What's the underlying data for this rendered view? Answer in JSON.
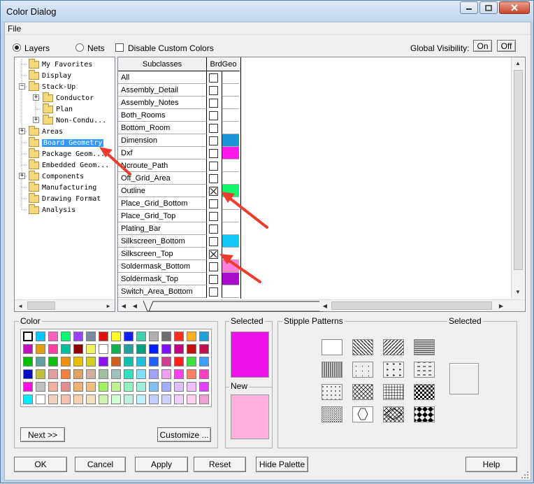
{
  "window": {
    "title": "Color Dialog"
  },
  "menu": {
    "file": "File"
  },
  "top_controls": {
    "layers_label": "Layers",
    "nets_label": "Nets",
    "disable_custom_label": "Disable Custom Colors",
    "global_visibility_label": "Global Visibility:",
    "on_label": "On",
    "off_label": "Off",
    "selected_radio": "Layers"
  },
  "tree": {
    "items": [
      {
        "label": "My Favorites",
        "selected": false
      },
      {
        "label": "Display",
        "selected": false
      },
      {
        "label": "Stack-Up",
        "selected": false
      },
      {
        "label": "Conductor",
        "selected": false
      },
      {
        "label": "Plan",
        "selected": false
      },
      {
        "label": "Non-Condu...",
        "selected": false
      },
      {
        "label": "Areas",
        "selected": false
      },
      {
        "label": "Board Geometry",
        "selected": true
      },
      {
        "label": "Package Geom...",
        "selected": false
      },
      {
        "label": "Embedded Geom...",
        "selected": false
      },
      {
        "label": "Components",
        "selected": false
      },
      {
        "label": "Manufacturing",
        "selected": false
      },
      {
        "label": "Drawing Format",
        "selected": false
      },
      {
        "label": "Analysis",
        "selected": false
      }
    ]
  },
  "grid": {
    "col_subclasses": "Subclasses",
    "col_brdgeo": "BrdGeo",
    "rows": [
      {
        "name": "All",
        "checked": false,
        "color": "#ffffff"
      },
      {
        "name": "Assembly_Detail",
        "checked": false,
        "color": "#ffffff"
      },
      {
        "name": "Assembly_Notes",
        "checked": false,
        "color": "#ffffff"
      },
      {
        "name": "Both_Rooms",
        "checked": false,
        "color": "#ffffff"
      },
      {
        "name": "Bottom_Room",
        "checked": false,
        "color": "#ffffff"
      },
      {
        "name": "Dimension",
        "checked": false,
        "color": "#1a96d6"
      },
      {
        "name": "Dxf",
        "checked": false,
        "color": "#ff18ec"
      },
      {
        "name": "Ncroute_Path",
        "checked": false,
        "color": "#ffffff"
      },
      {
        "name": "Off_Grid_Area",
        "checked": false,
        "color": "#ffffff"
      },
      {
        "name": "Outline",
        "checked": true,
        "color": "#10f56a"
      },
      {
        "name": "Place_Grid_Bottom",
        "checked": false,
        "color": "#ffffff"
      },
      {
        "name": "Place_Grid_Top",
        "checked": false,
        "color": "#ffffff"
      },
      {
        "name": "Plating_Bar",
        "checked": false,
        "color": "#ffffff"
      },
      {
        "name": "Silkscreen_Bottom",
        "checked": false,
        "color": "#11c8f6"
      },
      {
        "name": "Silkscreen_Top",
        "checked": true,
        "color": "#ffffff"
      },
      {
        "name": "Soldermask_Bottom",
        "checked": false,
        "color": "#ff7fd8"
      },
      {
        "name": "Soldermask_Top",
        "checked": false,
        "color": "#a80ccc"
      },
      {
        "name": "Switch_Area_Bottom",
        "checked": false,
        "color": "#ffffff"
      }
    ]
  },
  "color_panel": {
    "title": "Color",
    "next_label": "Next >>",
    "customize_label": "Customize ...",
    "palette": [
      "#ffffff",
      "#00c8ff",
      "#ff60c0",
      "#00ff70",
      "#9a40ff",
      "#7a8aa0",
      "#e01010",
      "#ffff20",
      "#1020ff",
      "#40d0b0",
      "#b0b0b0",
      "#707070",
      "#ff3020",
      "#ffb020",
      "#20a0e0",
      "#c010c0",
      "#e0a010",
      "#ff40a0",
      "#00c0a0",
      "#8c0000",
      "#f0f060",
      "#ffffff",
      "#10b050",
      "#20a0a0",
      "#00a080",
      "#0020ff",
      "#8010ff",
      "#c00080",
      "#c01010",
      "#c01050",
      "#00c000",
      "#60a0a0",
      "#10c010",
      "#f09010",
      "#e8c000",
      "#d0d020",
      "#9010f0",
      "#d06020",
      "#10c0b0",
      "#20c0e0",
      "#2060ff",
      "#d04090",
      "#ff2020",
      "#40e040",
      "#40a0ff",
      "#0010c0",
      "#c0c040",
      "#e0a0a0",
      "#f08040",
      "#e0a060",
      "#d0b0a0",
      "#a0c0a0",
      "#a0c0c0",
      "#30e0c0",
      "#80e0ff",
      "#a0a0ff",
      "#f0a0f0",
      "#ff40f0",
      "#ff8060",
      "#ff40c0",
      "#ff10e0",
      "#c0c0c0",
      "#f0b0a0",
      "#e09090",
      "#f0b070",
      "#f0c080",
      "#a0f060",
      "#c0f090",
      "#90f0c0",
      "#a0f0e0",
      "#80c0f0",
      "#a0b0ff",
      "#e0c0ff",
      "#f0c0ff",
      "#e040ff",
      "#00f0ff",
      "#ffffff",
      "#f0d0c0",
      "#f8c0b0",
      "#f8d0b0",
      "#f0e0c0",
      "#d0f0b0",
      "#d0ffd0",
      "#c0f0e0",
      "#c0f0ff",
      "#c0d0ff",
      "#d0d0ff",
      "#f0d0ff",
      "#ffd0f0",
      "#f0a0d0"
    ]
  },
  "selected_panel": {
    "selected_label": "Selected",
    "new_label": "New",
    "selected_color": "#ee10ea",
    "new_color": "#ffb0dc"
  },
  "stipple_panel": {
    "title": "Stipple Patterns",
    "selected_label": "Selected"
  },
  "buttons": {
    "ok": "OK",
    "cancel": "Cancel",
    "apply": "Apply",
    "reset": "Reset",
    "hide_palette": "Hide Palette",
    "help": "Help"
  }
}
